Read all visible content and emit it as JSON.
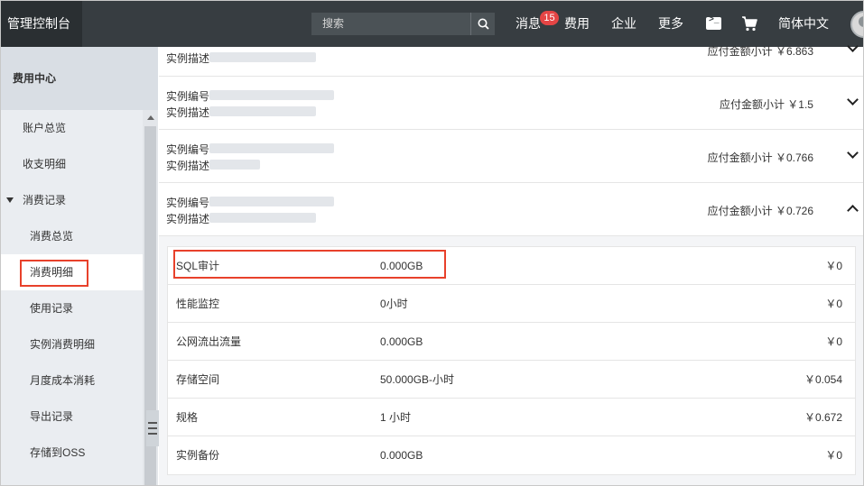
{
  "topbar": {
    "brand": "管理控制台",
    "search_placeholder": "搜索",
    "nav": {
      "messages": "消息",
      "messages_badge": "15",
      "fees": "费用",
      "enterprise": "企业",
      "more": "更多",
      "language": "简体中文"
    },
    "icons": [
      "search-icon",
      "terminal-icon",
      "cart-icon",
      "avatar"
    ]
  },
  "sidebar": {
    "title": "费用中心",
    "items": [
      {
        "label": "账户总览",
        "level": 1
      },
      {
        "label": "收支明细",
        "level": 1
      },
      {
        "label": "消费记录",
        "level": 1,
        "expanded": true
      },
      {
        "label": "消费总览",
        "level": 2
      },
      {
        "label": "消费明细",
        "level": 2,
        "active": true
      },
      {
        "label": "使用记录",
        "level": 2
      },
      {
        "label": "实例消费明细",
        "level": 2
      },
      {
        "label": "月度成本消耗",
        "level": 2
      },
      {
        "label": "导出记录",
        "level": 2
      },
      {
        "label": "存储到OSS",
        "level": 2
      }
    ]
  },
  "instances": [
    {
      "line1": "实例描述",
      "line2": "",
      "amount": "应付金额小计 ￥6.863",
      "expanded": false
    },
    {
      "line1": "实例编号",
      "line2": "实例描述",
      "amount": "应付金额小计 ￥1.5",
      "expanded": false
    },
    {
      "line1": "实例编号",
      "line2": "实例描述",
      "amount": "应付金额小计 ￥0.766",
      "expanded": false
    },
    {
      "line1": "实例编号",
      "line2": "实例描述",
      "amount": "应付金额小计 ￥0.726",
      "expanded": true
    }
  ],
  "detail_rows": [
    {
      "name": "SQL审计",
      "usage": "0.000GB",
      "cost": "￥0",
      "highlighted": true
    },
    {
      "name": "性能监控",
      "usage": "0小时",
      "cost": "￥0"
    },
    {
      "name": "公网流出流量",
      "usage": "0.000GB",
      "cost": "￥0"
    },
    {
      "name": "存储空间",
      "usage": "50.000GB-小时",
      "cost": "￥0.054"
    },
    {
      "name": "规格",
      "usage": "1 小时",
      "cost": "￥0.672"
    },
    {
      "name": "实例备份",
      "usage": "0.000GB",
      "cost": "￥0"
    }
  ],
  "colors": {
    "topbar": "#373d41",
    "brand_bg": "#2a2f32",
    "badge": "#e54545",
    "highlight_box": "#e8412b",
    "sidebar_bg": "#eaedf1"
  }
}
